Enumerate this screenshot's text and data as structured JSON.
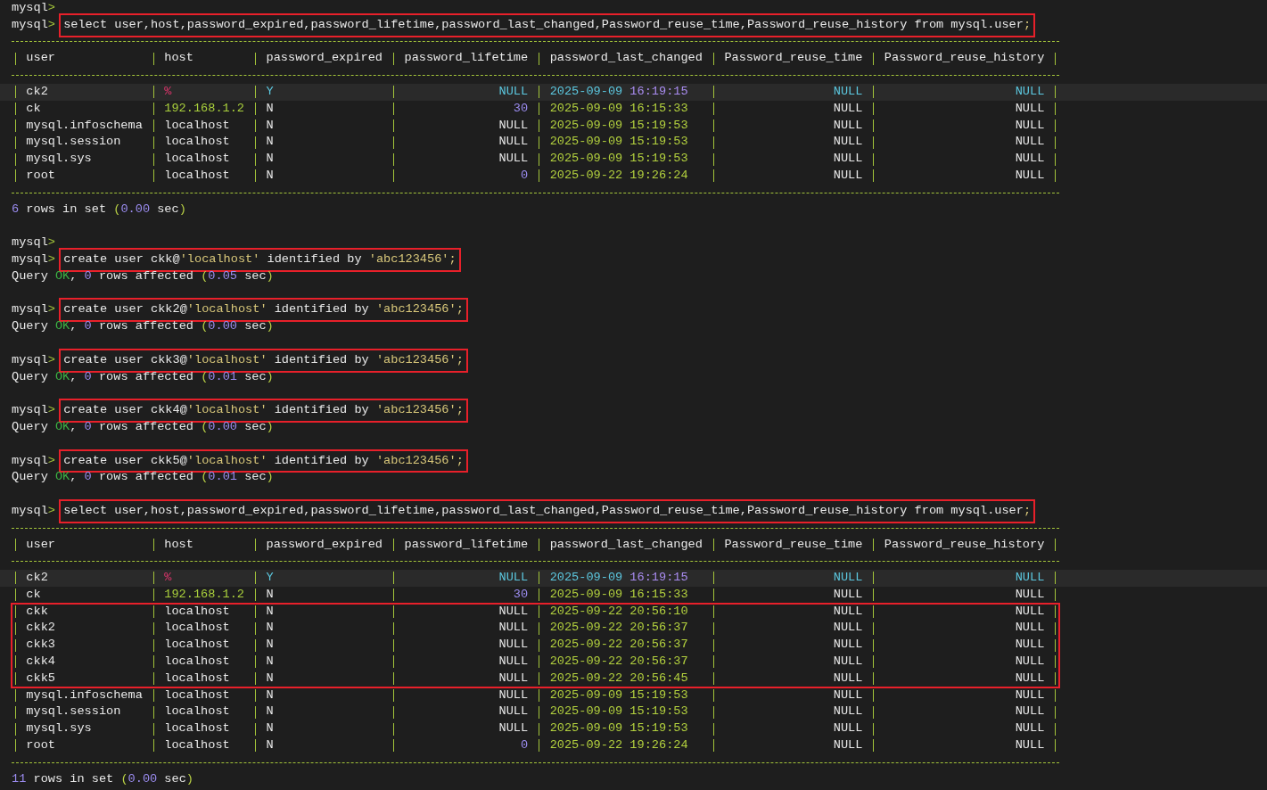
{
  "terminal": [
    {
      "kind": "prompt",
      "prompt": "mysql>"
    },
    {
      "kind": "prompt",
      "prompt": "mysql>",
      "command": {
        "boxed": true,
        "segments": [
          {
            "text": "select user,host,password_expired,password_lifetime,password_last_changed,Password_reuse_time,Password_reuse_history from mysql.user",
            "kind": "plain"
          },
          {
            "text": ";",
            "kind": "punct"
          }
        ]
      }
    },
    {
      "kind": "table",
      "columns": [
        {
          "name": "user",
          "kind": "text"
        },
        {
          "name": "host",
          "kind": "text"
        },
        {
          "name": "password_expired",
          "kind": "text"
        },
        {
          "name": "password_lifetime",
          "kind": "numeric"
        },
        {
          "name": "password_last_changed",
          "kind": "text"
        },
        {
          "name": "Password_reuse_time",
          "kind": "numeric"
        },
        {
          "name": "Password_reuse_history",
          "kind": "numeric"
        }
      ],
      "rows": [
        {
          "selected": true,
          "boxed": false,
          "cells": [
            {
              "text": "ck2",
              "kind": "text"
            },
            {
              "text": "%",
              "kind": "wildcard"
            },
            {
              "text": "Y",
              "kind": "flag"
            },
            {
              "text": "NULL",
              "kind": "null"
            },
            {
              "text": "2025-09-09 16:19:15",
              "kind": "datetime"
            },
            {
              "text": "NULL",
              "kind": "null"
            },
            {
              "text": "NULL",
              "kind": "null"
            }
          ]
        },
        {
          "selected": false,
          "boxed": false,
          "cells": [
            {
              "text": "ck",
              "kind": "text"
            },
            {
              "text": "192.168.1.2",
              "kind": "ip"
            },
            {
              "text": "N",
              "kind": "flag"
            },
            {
              "text": "30",
              "kind": "number"
            },
            {
              "text": "2025-09-09 16:15:33",
              "kind": "datetime"
            },
            {
              "text": "NULL",
              "kind": "null"
            },
            {
              "text": "NULL",
              "kind": "null"
            }
          ]
        },
        {
          "selected": false,
          "boxed": false,
          "cells": [
            {
              "text": "mysql.infoschema",
              "kind": "text"
            },
            {
              "text": "localhost",
              "kind": "text"
            },
            {
              "text": "N",
              "kind": "flag"
            },
            {
              "text": "NULL",
              "kind": "null"
            },
            {
              "text": "2025-09-09 15:19:53",
              "kind": "datetime"
            },
            {
              "text": "NULL",
              "kind": "null"
            },
            {
              "text": "NULL",
              "kind": "null"
            }
          ]
        },
        {
          "selected": false,
          "boxed": false,
          "cells": [
            {
              "text": "mysql.session",
              "kind": "text"
            },
            {
              "text": "localhost",
              "kind": "text"
            },
            {
              "text": "N",
              "kind": "flag"
            },
            {
              "text": "NULL",
              "kind": "null"
            },
            {
              "text": "2025-09-09 15:19:53",
              "kind": "datetime"
            },
            {
              "text": "NULL",
              "kind": "null"
            },
            {
              "text": "NULL",
              "kind": "null"
            }
          ]
        },
        {
          "selected": false,
          "boxed": false,
          "cells": [
            {
              "text": "mysql.sys",
              "kind": "text"
            },
            {
              "text": "localhost",
              "kind": "text"
            },
            {
              "text": "N",
              "kind": "flag"
            },
            {
              "text": "NULL",
              "kind": "null"
            },
            {
              "text": "2025-09-09 15:19:53",
              "kind": "datetime"
            },
            {
              "text": "NULL",
              "kind": "null"
            },
            {
              "text": "NULL",
              "kind": "null"
            }
          ]
        },
        {
          "selected": false,
          "boxed": false,
          "cells": [
            {
              "text": "root",
              "kind": "text"
            },
            {
              "text": "localhost",
              "kind": "text"
            },
            {
              "text": "N",
              "kind": "flag"
            },
            {
              "text": "0",
              "kind": "number"
            },
            {
              "text": "2025-09-22 19:26:24",
              "kind": "datetime"
            },
            {
              "text": "NULL",
              "kind": "null"
            },
            {
              "text": "NULL",
              "kind": "null"
            }
          ]
        }
      ]
    },
    {
      "kind": "output",
      "segments": [
        {
          "text": "6",
          "kind": "number"
        },
        {
          "text": " rows in set ",
          "kind": "plain"
        },
        {
          "text": "(",
          "kind": "paren"
        },
        {
          "text": "0.00",
          "kind": "number"
        },
        {
          "text": " sec",
          "kind": "plain"
        },
        {
          "text": ")",
          "kind": "paren"
        }
      ]
    },
    {
      "kind": "blank"
    },
    {
      "kind": "prompt",
      "prompt": "mysql>"
    },
    {
      "kind": "prompt",
      "prompt": "mysql>",
      "command": {
        "boxed": true,
        "segments": [
          {
            "text": "create user ckk@",
            "kind": "plain"
          },
          {
            "text": "'localhost'",
            "kind": "string"
          },
          {
            "text": " identified by ",
            "kind": "plain"
          },
          {
            "text": "'abc123456'",
            "kind": "string"
          },
          {
            "text": ";",
            "kind": "punct"
          }
        ]
      }
    },
    {
      "kind": "output",
      "segments": [
        {
          "text": "Query ",
          "kind": "plain"
        },
        {
          "text": "OK",
          "kind": "ok"
        },
        {
          "text": ", ",
          "kind": "plain"
        },
        {
          "text": "0",
          "kind": "number"
        },
        {
          "text": " rows affected ",
          "kind": "plain"
        },
        {
          "text": "(",
          "kind": "paren"
        },
        {
          "text": "0.05",
          "kind": "number"
        },
        {
          "text": " sec",
          "kind": "plain"
        },
        {
          "text": ")",
          "kind": "paren"
        }
      ]
    },
    {
      "kind": "blank"
    },
    {
      "kind": "prompt",
      "prompt": "mysql>",
      "command": {
        "boxed": true,
        "segments": [
          {
            "text": "create user ckk2@",
            "kind": "plain"
          },
          {
            "text": "'localhost'",
            "kind": "string"
          },
          {
            "text": " identified by ",
            "kind": "plain"
          },
          {
            "text": "'abc123456'",
            "kind": "string"
          },
          {
            "text": ";",
            "kind": "punct"
          }
        ]
      }
    },
    {
      "kind": "output",
      "segments": [
        {
          "text": "Query ",
          "kind": "plain"
        },
        {
          "text": "OK",
          "kind": "ok"
        },
        {
          "text": ", ",
          "kind": "plain"
        },
        {
          "text": "0",
          "kind": "number"
        },
        {
          "text": " rows affected ",
          "kind": "plain"
        },
        {
          "text": "(",
          "kind": "paren"
        },
        {
          "text": "0.00",
          "kind": "number"
        },
        {
          "text": " sec",
          "kind": "plain"
        },
        {
          "text": ")",
          "kind": "paren"
        }
      ]
    },
    {
      "kind": "blank"
    },
    {
      "kind": "prompt",
      "prompt": "mysql>",
      "command": {
        "boxed": true,
        "segments": [
          {
            "text": "create user ckk3@",
            "kind": "plain"
          },
          {
            "text": "'localhost'",
            "kind": "string"
          },
          {
            "text": " identified by ",
            "kind": "plain"
          },
          {
            "text": "'abc123456'",
            "kind": "string"
          },
          {
            "text": ";",
            "kind": "punct"
          }
        ]
      }
    },
    {
      "kind": "output",
      "segments": [
        {
          "text": "Query ",
          "kind": "plain"
        },
        {
          "text": "OK",
          "kind": "ok"
        },
        {
          "text": ", ",
          "kind": "plain"
        },
        {
          "text": "0",
          "kind": "number"
        },
        {
          "text": " rows affected ",
          "kind": "plain"
        },
        {
          "text": "(",
          "kind": "paren"
        },
        {
          "text": "0.01",
          "kind": "number"
        },
        {
          "text": " sec",
          "kind": "plain"
        },
        {
          "text": ")",
          "kind": "paren"
        }
      ]
    },
    {
      "kind": "blank"
    },
    {
      "kind": "prompt",
      "prompt": "mysql>",
      "command": {
        "boxed": true,
        "segments": [
          {
            "text": "create user ckk4@",
            "kind": "plain"
          },
          {
            "text": "'localhost'",
            "kind": "string"
          },
          {
            "text": " identified by ",
            "kind": "plain"
          },
          {
            "text": "'abc123456'",
            "kind": "string"
          },
          {
            "text": ";",
            "kind": "punct"
          }
        ]
      }
    },
    {
      "kind": "output",
      "segments": [
        {
          "text": "Query ",
          "kind": "plain"
        },
        {
          "text": "OK",
          "kind": "ok"
        },
        {
          "text": ", ",
          "kind": "plain"
        },
        {
          "text": "0",
          "kind": "number"
        },
        {
          "text": " rows affected ",
          "kind": "plain"
        },
        {
          "text": "(",
          "kind": "paren"
        },
        {
          "text": "0.00",
          "kind": "number"
        },
        {
          "text": " sec",
          "kind": "plain"
        },
        {
          "text": ")",
          "kind": "paren"
        }
      ]
    },
    {
      "kind": "blank"
    },
    {
      "kind": "prompt",
      "prompt": "mysql>",
      "command": {
        "boxed": true,
        "segments": [
          {
            "text": "create user ckk5@",
            "kind": "plain"
          },
          {
            "text": "'localhost'",
            "kind": "string"
          },
          {
            "text": " identified by ",
            "kind": "plain"
          },
          {
            "text": "'abc123456'",
            "kind": "string"
          },
          {
            "text": ";",
            "kind": "punct"
          }
        ]
      }
    },
    {
      "kind": "output",
      "segments": [
        {
          "text": "Query ",
          "kind": "plain"
        },
        {
          "text": "OK",
          "kind": "ok"
        },
        {
          "text": ", ",
          "kind": "plain"
        },
        {
          "text": "0",
          "kind": "number"
        },
        {
          "text": " rows affected ",
          "kind": "plain"
        },
        {
          "text": "(",
          "kind": "paren"
        },
        {
          "text": "0.01",
          "kind": "number"
        },
        {
          "text": " sec",
          "kind": "plain"
        },
        {
          "text": ")",
          "kind": "paren"
        }
      ]
    },
    {
      "kind": "blank"
    },
    {
      "kind": "prompt",
      "prompt": "mysql>",
      "command": {
        "boxed": true,
        "segments": [
          {
            "text": "select user,host,password_expired,password_lifetime,password_last_changed,Password_reuse_time,Password_reuse_history from mysql.user",
            "kind": "plain"
          },
          {
            "text": ";",
            "kind": "punct"
          }
        ]
      }
    },
    {
      "kind": "table",
      "columns": [
        {
          "name": "user",
          "kind": "text"
        },
        {
          "name": "host",
          "kind": "text"
        },
        {
          "name": "password_expired",
          "kind": "text"
        },
        {
          "name": "password_lifetime",
          "kind": "numeric"
        },
        {
          "name": "password_last_changed",
          "kind": "text"
        },
        {
          "name": "Password_reuse_time",
          "kind": "numeric"
        },
        {
          "name": "Password_reuse_history",
          "kind": "numeric"
        }
      ],
      "rows": [
        {
          "selected": true,
          "boxed": false,
          "cells": [
            {
              "text": "ck2",
              "kind": "text"
            },
            {
              "text": "%",
              "kind": "wildcard"
            },
            {
              "text": "Y",
              "kind": "flag"
            },
            {
              "text": "NULL",
              "kind": "null"
            },
            {
              "text": "2025-09-09 16:19:15",
              "kind": "datetime"
            },
            {
              "text": "NULL",
              "kind": "null"
            },
            {
              "text": "NULL",
              "kind": "null"
            }
          ]
        },
        {
          "selected": false,
          "boxed": false,
          "cells": [
            {
              "text": "ck",
              "kind": "text"
            },
            {
              "text": "192.168.1.2",
              "kind": "ip"
            },
            {
              "text": "N",
              "kind": "flag"
            },
            {
              "text": "30",
              "kind": "number"
            },
            {
              "text": "2025-09-09 16:15:33",
              "kind": "datetime"
            },
            {
              "text": "NULL",
              "kind": "null"
            },
            {
              "text": "NULL",
              "kind": "null"
            }
          ]
        },
        {
          "selected": false,
          "boxed": true,
          "cells": [
            {
              "text": "ckk",
              "kind": "text"
            },
            {
              "text": "localhost",
              "kind": "text"
            },
            {
              "text": "N",
              "kind": "flag"
            },
            {
              "text": "NULL",
              "kind": "null"
            },
            {
              "text": "2025-09-22 20:56:10",
              "kind": "datetime"
            },
            {
              "text": "NULL",
              "kind": "null"
            },
            {
              "text": "NULL",
              "kind": "null"
            }
          ]
        },
        {
          "selected": false,
          "boxed": true,
          "cells": [
            {
              "text": "ckk2",
              "kind": "text"
            },
            {
              "text": "localhost",
              "kind": "text"
            },
            {
              "text": "N",
              "kind": "flag"
            },
            {
              "text": "NULL",
              "kind": "null"
            },
            {
              "text": "2025-09-22 20:56:37",
              "kind": "datetime"
            },
            {
              "text": "NULL",
              "kind": "null"
            },
            {
              "text": "NULL",
              "kind": "null"
            }
          ]
        },
        {
          "selected": false,
          "boxed": true,
          "cells": [
            {
              "text": "ckk3",
              "kind": "text"
            },
            {
              "text": "localhost",
              "kind": "text"
            },
            {
              "text": "N",
              "kind": "flag"
            },
            {
              "text": "NULL",
              "kind": "null"
            },
            {
              "text": "2025-09-22 20:56:37",
              "kind": "datetime"
            },
            {
              "text": "NULL",
              "kind": "null"
            },
            {
              "text": "NULL",
              "kind": "null"
            }
          ]
        },
        {
          "selected": false,
          "boxed": true,
          "cells": [
            {
              "text": "ckk4",
              "kind": "text"
            },
            {
              "text": "localhost",
              "kind": "text"
            },
            {
              "text": "N",
              "kind": "flag"
            },
            {
              "text": "NULL",
              "kind": "null"
            },
            {
              "text": "2025-09-22 20:56:37",
              "kind": "datetime"
            },
            {
              "text": "NULL",
              "kind": "null"
            },
            {
              "text": "NULL",
              "kind": "null"
            }
          ]
        },
        {
          "selected": false,
          "boxed": true,
          "cells": [
            {
              "text": "ckk5",
              "kind": "text"
            },
            {
              "text": "localhost",
              "kind": "text"
            },
            {
              "text": "N",
              "kind": "flag"
            },
            {
              "text": "NULL",
              "kind": "null"
            },
            {
              "text": "2025-09-22 20:56:45",
              "kind": "datetime"
            },
            {
              "text": "NULL",
              "kind": "null"
            },
            {
              "text": "NULL",
              "kind": "null"
            }
          ]
        },
        {
          "selected": false,
          "boxed": false,
          "cells": [
            {
              "text": "mysql.infoschema",
              "kind": "text"
            },
            {
              "text": "localhost",
              "kind": "text"
            },
            {
              "text": "N",
              "kind": "flag"
            },
            {
              "text": "NULL",
              "kind": "null"
            },
            {
              "text": "2025-09-09 15:19:53",
              "kind": "datetime"
            },
            {
              "text": "NULL",
              "kind": "null"
            },
            {
              "text": "NULL",
              "kind": "null"
            }
          ]
        },
        {
          "selected": false,
          "boxed": false,
          "cells": [
            {
              "text": "mysql.session",
              "kind": "text"
            },
            {
              "text": "localhost",
              "kind": "text"
            },
            {
              "text": "N",
              "kind": "flag"
            },
            {
              "text": "NULL",
              "kind": "null"
            },
            {
              "text": "2025-09-09 15:19:53",
              "kind": "datetime"
            },
            {
              "text": "NULL",
              "kind": "null"
            },
            {
              "text": "NULL",
              "kind": "null"
            }
          ]
        },
        {
          "selected": false,
          "boxed": false,
          "cells": [
            {
              "text": "mysql.sys",
              "kind": "text"
            },
            {
              "text": "localhost",
              "kind": "text"
            },
            {
              "text": "N",
              "kind": "flag"
            },
            {
              "text": "NULL",
              "kind": "null"
            },
            {
              "text": "2025-09-09 15:19:53",
              "kind": "datetime"
            },
            {
              "text": "NULL",
              "kind": "null"
            },
            {
              "text": "NULL",
              "kind": "null"
            }
          ]
        },
        {
          "selected": false,
          "boxed": false,
          "cells": [
            {
              "text": "root",
              "kind": "text"
            },
            {
              "text": "localhost",
              "kind": "text"
            },
            {
              "text": "N",
              "kind": "flag"
            },
            {
              "text": "0",
              "kind": "number"
            },
            {
              "text": "2025-09-22 19:26:24",
              "kind": "datetime"
            },
            {
              "text": "NULL",
              "kind": "null"
            },
            {
              "text": "NULL",
              "kind": "null"
            }
          ]
        }
      ]
    },
    {
      "kind": "output",
      "segments": [
        {
          "text": "11",
          "kind": "number"
        },
        {
          "text": " rows in set ",
          "kind": "plain"
        },
        {
          "text": "(",
          "kind": "paren"
        },
        {
          "text": "0.00",
          "kind": "number"
        },
        {
          "text": " sec",
          "kind": "plain"
        },
        {
          "text": ")",
          "kind": "paren"
        }
      ]
    }
  ]
}
